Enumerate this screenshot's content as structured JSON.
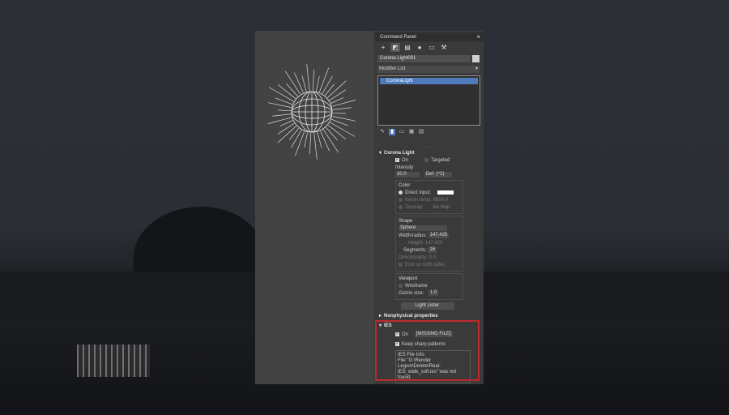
{
  "panel": {
    "title": "Command Panel",
    "close_glyph": "×",
    "tabs": [
      {
        "icon": "create-icon",
        "glyph": "+"
      },
      {
        "icon": "modify-icon",
        "glyph": "◩"
      },
      {
        "icon": "hierarchy-icon",
        "glyph": "▤"
      },
      {
        "icon": "motion-icon",
        "glyph": "●"
      },
      {
        "icon": "display-icon",
        "glyph": "▭"
      },
      {
        "icon": "utilities-icon",
        "glyph": "⚒"
      }
    ],
    "object_name": "Corona Light001",
    "modifier_list": "Modifier List",
    "modifier_arrow": "▾",
    "stack_item": "CoronaLight",
    "separator": "····"
  },
  "corona_light": {
    "header": "Corona Light",
    "on_label": "On",
    "targeted_label": "Targeted",
    "intensity_label": "Intensity",
    "intensity_value": "30.0",
    "intensity_unit": "Def. (^2)",
    "color_label": "Color",
    "direct_input": "Direct input:",
    "kelvin_temp": "Kelvin temp:",
    "kelvin_value": "6500.0",
    "texmap": "Texmap:",
    "texmap_value": "No Map",
    "shape_label": "Shape",
    "shape_value": "Sphere",
    "width_label": "Width/radius:",
    "width_value": "147,425",
    "height_label": "Height:",
    "height_value": "147,425",
    "segments_label": "Segments:",
    "segments_value": "16",
    "directionality_label": "Directionality:",
    "directionality_value": "0.0",
    "emit_both": "Emit on both sides",
    "viewport_label": "Viewport",
    "wireframe_label": "Wireframe",
    "gizmo_label": "Gizmo size:",
    "gizmo_value": "1.0",
    "light_lister": "Light Lister"
  },
  "nonphysical": {
    "header": "Nonphysical properties"
  },
  "ies": {
    "header": "IES",
    "on_label": "On",
    "file_value": "[MISSING FILE]",
    "keep_sharp": "Keep sharp patterns",
    "info_title": "IES File Info",
    "info_text": "File \"G:\\Render Legion\\Delete\\Real-IES_wide_soft.ies\" was not found."
  },
  "colors": {
    "highlight": "#c0282c",
    "selection": "#4f7bbd"
  }
}
